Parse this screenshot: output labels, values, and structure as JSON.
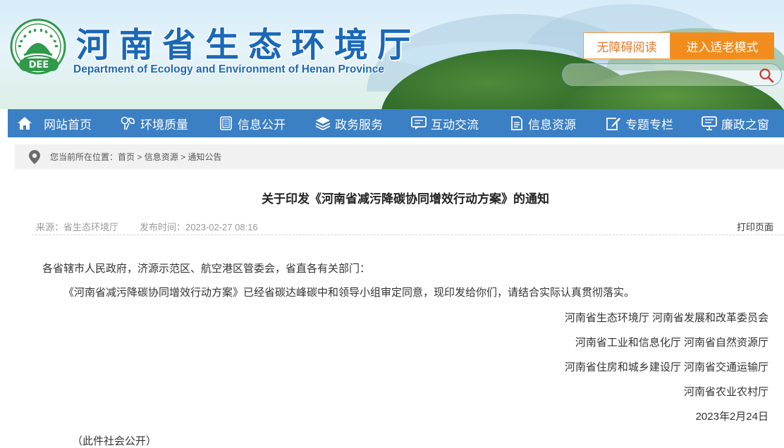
{
  "header": {
    "title": "河南省生态环境厅",
    "subtitle": "Department of Ecology and Environment of Henan Province",
    "logo_text": "DEE",
    "accessible_button": "无障碍阅读",
    "elder_button": "进入适老模式",
    "search_placeholder": "",
    "search_icon": "search-icon"
  },
  "nav": {
    "items": [
      {
        "label": "网站首页",
        "icon": "home-icon"
      },
      {
        "label": "环境质量",
        "icon": "eco-icon"
      },
      {
        "label": "信息公开",
        "icon": "document-icon"
      },
      {
        "label": "政务服务",
        "icon": "layers-icon"
      },
      {
        "label": "互动交流",
        "icon": "chat-icon"
      },
      {
        "label": "信息资源",
        "icon": "file-icon"
      },
      {
        "label": "专题专栏",
        "icon": "edit-icon"
      },
      {
        "label": "廉政之窗",
        "icon": "monitor-icon"
      }
    ]
  },
  "breadcrumb": {
    "prefix": "您当前所在位置：",
    "items": [
      "首页",
      "信息资源",
      "通知公告"
    ],
    "separator": " > "
  },
  "article": {
    "title": "关于印发《河南省减污降碳协同增效行动方案》的通知",
    "source": "来源：省生态环境厅",
    "publish_time": "发布时间：2023-02-27 08:16",
    "print_label": "打印页面",
    "salutation": "各省辖市人民政府，济源示范区、航空港区管委会，省直各有关部门：",
    "paragraph": "《河南省减污降碳协同增效行动方案》已经省碳达峰碳中和领导小组审定同意，现印发给你们，请结合实际认真贯彻落实。",
    "signatories": [
      "河南省生态环境厅 河南省发展和改革委员会",
      "河南省工业和信息化厅 河南省自然资源厅",
      "河南省住房和城乡建设厅 河南省交通运输厅",
      "河南省农业农村厅"
    ],
    "date": "2023年2月24日",
    "note": "（此件社会公开）"
  },
  "colors": {
    "brand_blue": "#1a68b8",
    "nav_blue": "#3b7fc4",
    "accent_orange": "#f28c1c",
    "logo_green": "#2e9a4a"
  }
}
